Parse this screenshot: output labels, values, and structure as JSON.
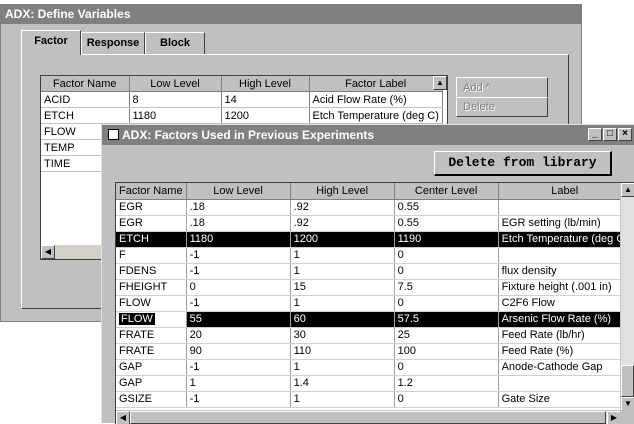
{
  "define_window": {
    "title": "ADX: Define Variables",
    "tabs": [
      {
        "label": "Factor"
      },
      {
        "label": "Response"
      },
      {
        "label": "Block"
      }
    ],
    "grid": {
      "headers": [
        "Factor Name",
        "Low Level",
        "High Level",
        "Factor Label"
      ],
      "rows": [
        [
          "ACID",
          "8",
          "14",
          "Acid Flow Rate (%)"
        ],
        [
          "ETCH",
          "1180",
          "1200",
          "Etch Temperature (deg C)"
        ],
        [
          "FLOW",
          "",
          "",
          ""
        ],
        [
          "TEMP",
          "",
          "",
          ""
        ],
        [
          "TIME",
          "",
          "",
          ""
        ]
      ]
    },
    "buttons": {
      "add": "Add ^",
      "delete": "Delete"
    }
  },
  "factors_window": {
    "title": "ADX: Factors Used in Previous Experiments",
    "controls": {
      "minimize": "_",
      "maximize": "□",
      "close": "×"
    },
    "delete_button": "Delete from library",
    "headers": [
      "Factor Name",
      "Low Level",
      "High Level",
      "Center Level",
      "Label"
    ],
    "rows": [
      [
        "EGR",
        ".18",
        ".92",
        "0.55",
        ""
      ],
      [
        "EGR",
        ".18",
        ".92",
        "0.55",
        "EGR setting (lb/min)"
      ],
      [
        "ETCH",
        "1180",
        "1200",
        "1190",
        "Etch Temperature (deg C)"
      ],
      [
        "F",
        "-1",
        "1",
        "0",
        ""
      ],
      [
        "FDENS",
        "-1",
        "1",
        "0",
        "flux density"
      ],
      [
        "FHEIGHT",
        "0",
        "15",
        "7.5",
        "Fixture height (.001 in)"
      ],
      [
        "FLOW",
        "-1",
        "1",
        "0",
        "C2F6 Flow"
      ],
      [
        "FLOW",
        "55",
        "60",
        "57.5",
        "Arsenic Flow Rate (%)"
      ],
      [
        "FRATE",
        "20",
        "30",
        "25",
        "Feed Rate (lb/hr)"
      ],
      [
        "FRATE",
        "90",
        "110",
        "100",
        "Feed Rate (%)"
      ],
      [
        "GAP",
        "-1",
        "1",
        "0",
        "Anode-Cathode Gap"
      ],
      [
        "GAP",
        "1",
        "1.4",
        "1.2",
        ""
      ],
      [
        "GSIZE",
        "-1",
        "1",
        "0",
        "Gate Size"
      ]
    ],
    "selected_rows": [
      2,
      7
    ]
  }
}
